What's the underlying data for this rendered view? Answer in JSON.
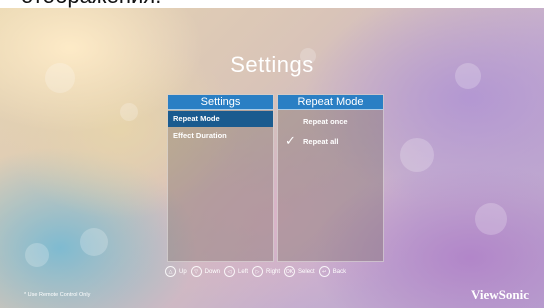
{
  "caption": "отображения.",
  "screen_title": "Settings",
  "left_panel": {
    "header": "Settings",
    "items": [
      {
        "label": "Repeat Mode",
        "selected": true
      },
      {
        "label": "Effect Duration",
        "selected": false
      }
    ]
  },
  "right_panel": {
    "header": "Repeat Mode",
    "options": [
      {
        "label": "Repeat once",
        "checked": false
      },
      {
        "label": "Repeat all",
        "checked": true
      }
    ]
  },
  "hints": [
    {
      "icon": "up-icon",
      "glyph": "△",
      "label": "Up"
    },
    {
      "icon": "down-icon",
      "glyph": "▽",
      "label": "Down"
    },
    {
      "icon": "left-icon",
      "glyph": "◁",
      "label": "Left"
    },
    {
      "icon": "right-icon",
      "glyph": "▷",
      "label": "Right"
    },
    {
      "icon": "ok-icon",
      "glyph": "OK",
      "label": "Select"
    },
    {
      "icon": "back-icon",
      "glyph": "↩",
      "label": "Back"
    }
  ],
  "footnote": "* Use Remote Control Only",
  "brand": "ViewSonic",
  "colors": {
    "accent": "#2a7fc4",
    "selected": "#1a5b8f"
  }
}
